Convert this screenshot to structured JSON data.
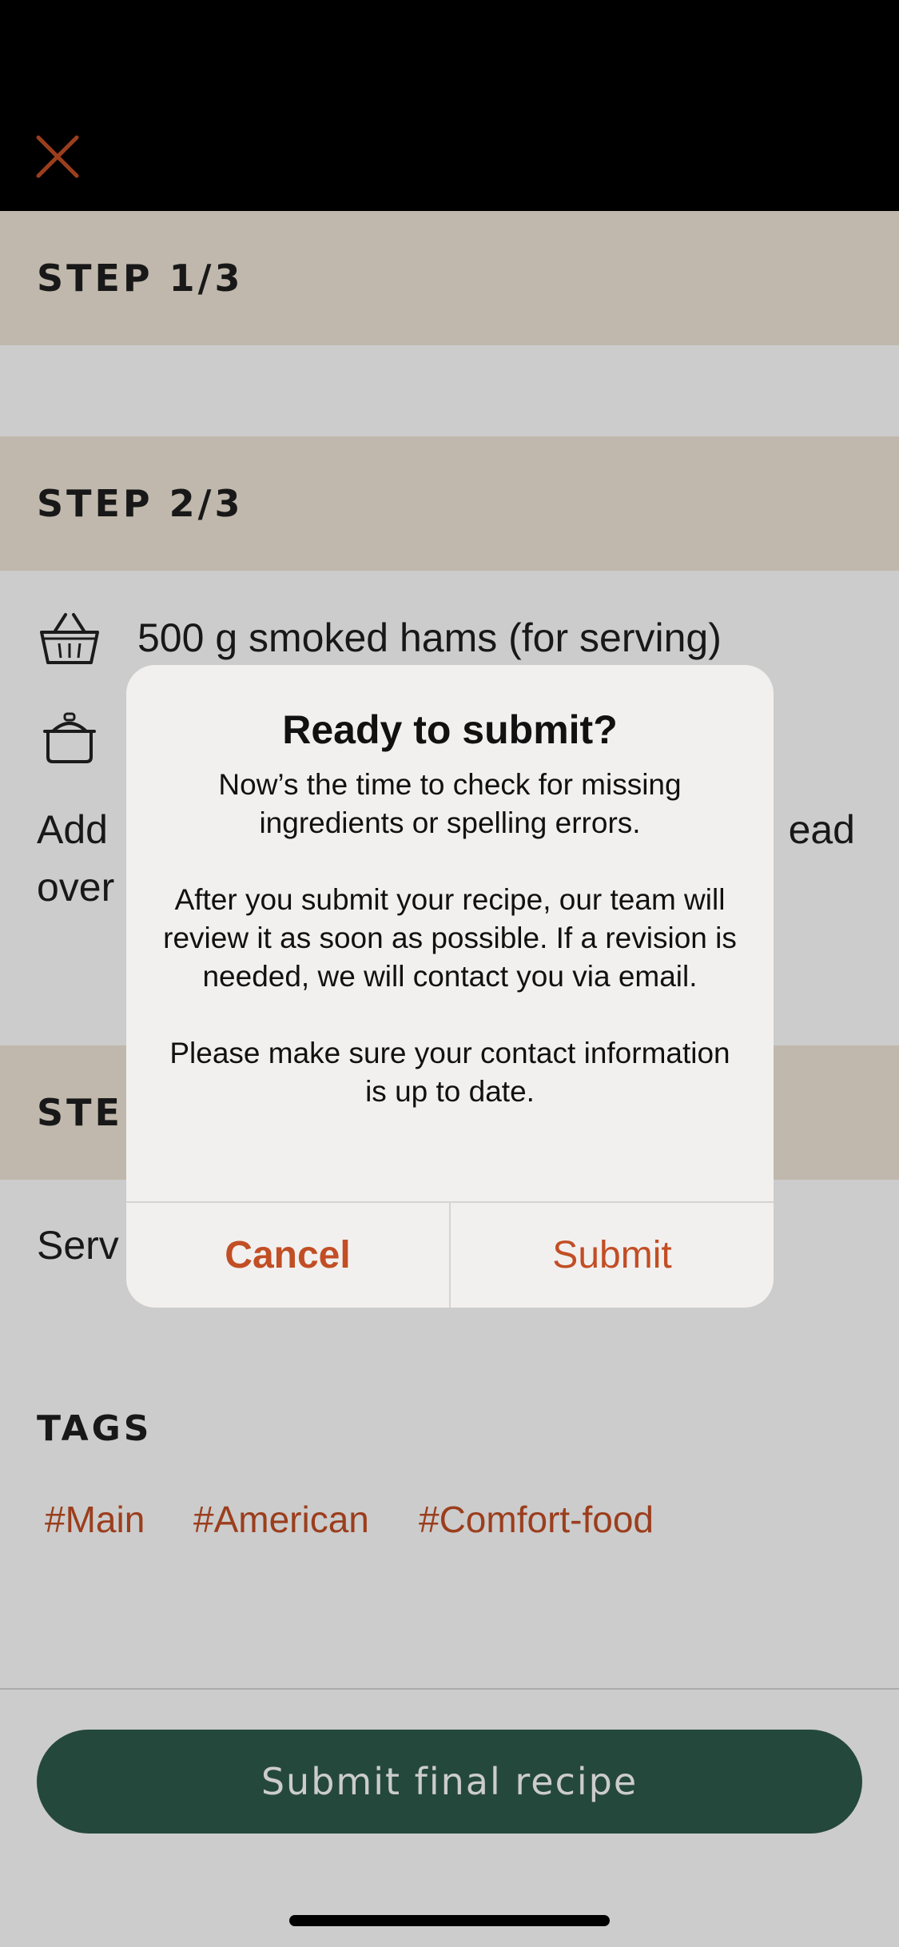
{
  "header": {
    "close_icon": "close-icon",
    "accent_color": "#c24e25"
  },
  "steps": [
    {
      "title": "STEP 1/3"
    },
    {
      "title": "STEP 2/3"
    },
    {
      "title": "STEP"
    }
  ],
  "ingredients": [
    {
      "icon": "basket-icon",
      "text": "500 g smoked hams (for serving)"
    },
    {
      "icon": "pot-icon",
      "text": ""
    }
  ],
  "instructions": {
    "line1_left": "Add",
    "line1_right": "ead",
    "line2_left": "over"
  },
  "servings": {
    "label_partial": "Serv"
  },
  "tags": {
    "title": "TAGS",
    "items": [
      "#Main",
      "#American",
      "#Comfort-food"
    ]
  },
  "footer": {
    "primary_button": "Submit final recipe",
    "primary_color": "#2f5b4b"
  },
  "dialog": {
    "title": "Ready to submit?",
    "message": "Now’s the time to check for missing ingredients or spelling errors.\n\nAfter you submit your recipe, our team will review it as soon as possible. If a revision is needed, we will contact you via email.\n\nPlease make sure your contact information is up to date.",
    "cancel_label": "Cancel",
    "submit_label": "Submit"
  }
}
